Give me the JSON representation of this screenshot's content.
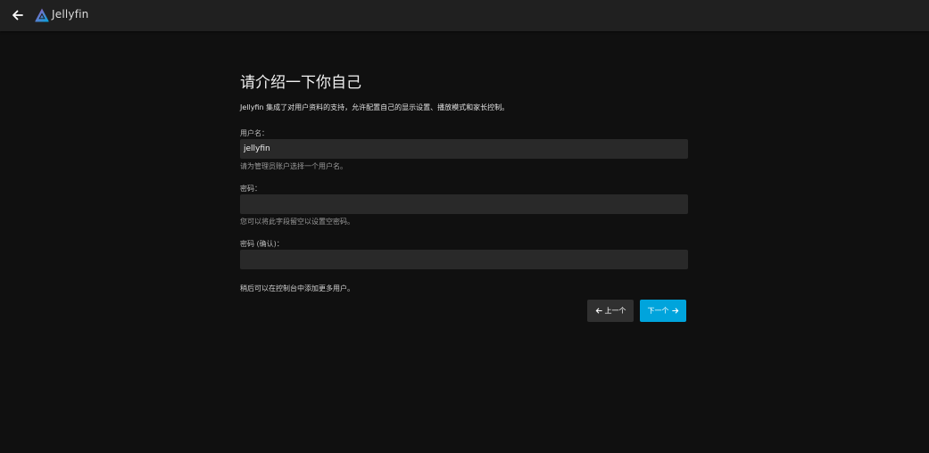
{
  "header": {
    "brand": "Jellyfin",
    "icons": {
      "back": "arrow-left-icon",
      "logo": "jellyfin-logo-icon"
    }
  },
  "wizard": {
    "title": "请介绍一下你自己",
    "intro": "Jellyfin 集成了对用户资料的支持，允许配置自己的显示设置、播放模式和家长控制。",
    "username": {
      "label": "用户名：",
      "value": "jellyfin",
      "hint": "请为管理员账户选择一个用户名。"
    },
    "password": {
      "label": "密码：",
      "value": "",
      "hint": "您可以将此字段留空以设置空密码。"
    },
    "password_confirm": {
      "label": "密码 (确认)：",
      "value": ""
    },
    "footer_note": "稍后可以在控制台中添加更多用户。",
    "buttons": {
      "prev": "上一个",
      "next": "下一个"
    }
  },
  "colors": {
    "background": "#101010",
    "header": "#202020",
    "input": "#292929",
    "accent": "#00a4dc",
    "button_secondary": "#303030"
  }
}
